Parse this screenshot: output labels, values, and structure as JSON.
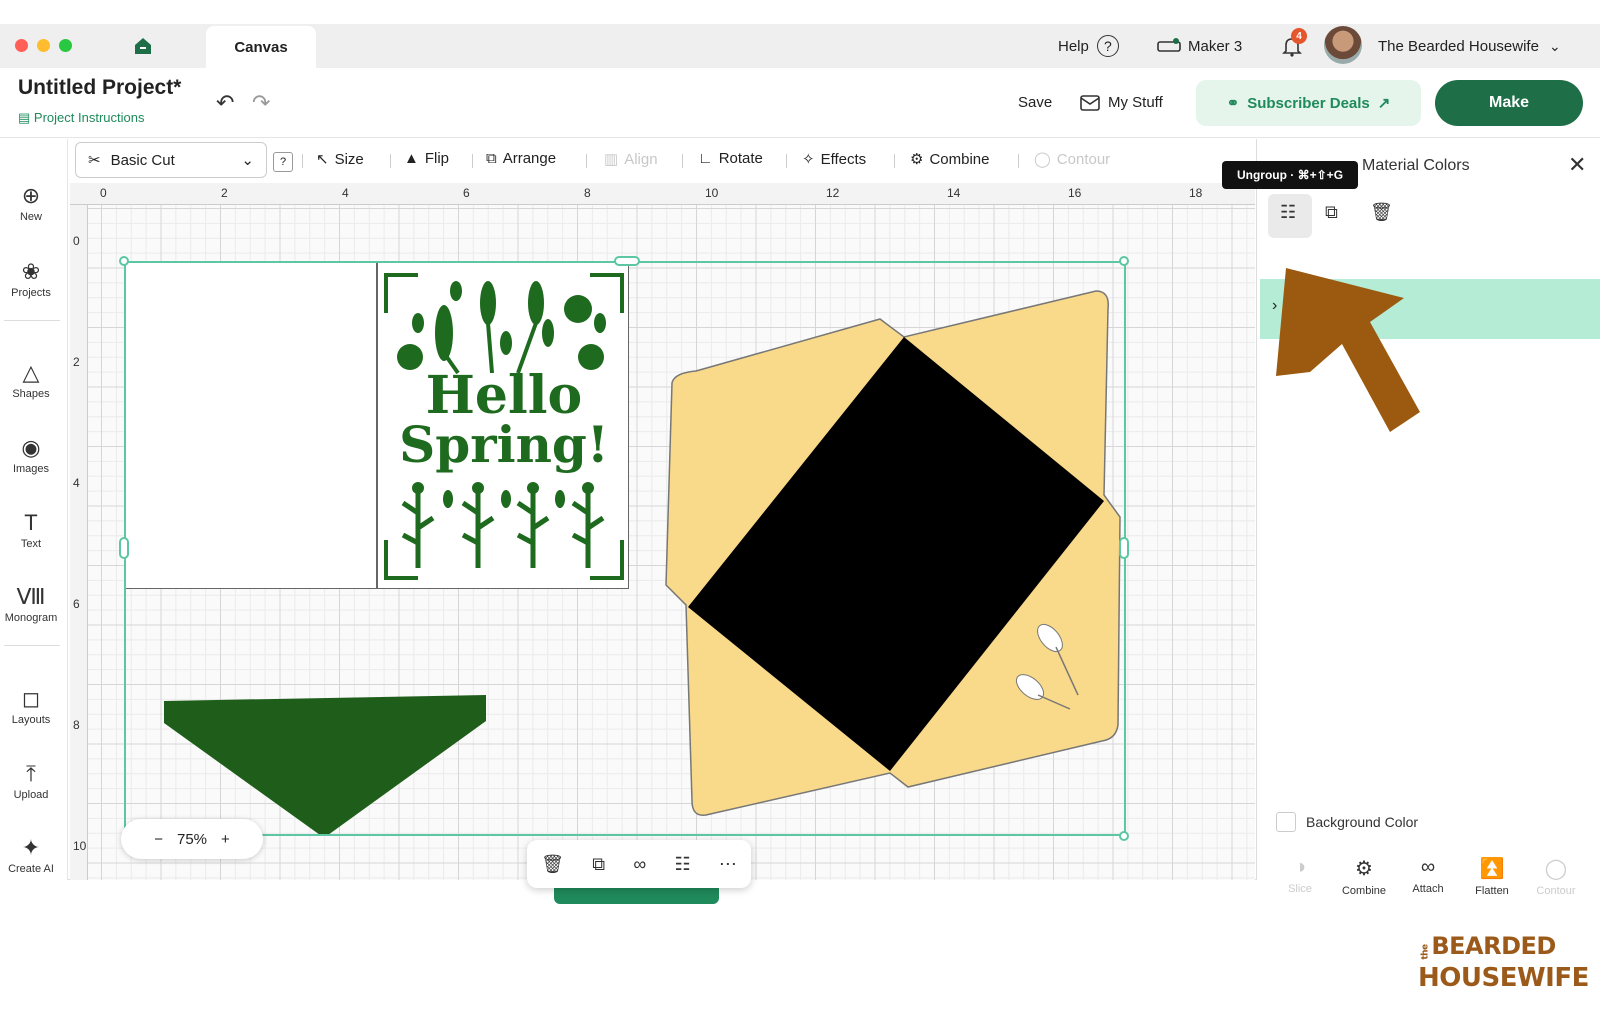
{
  "titlebar": {
    "tab": "Canvas",
    "help": "Help",
    "help_icon": "?",
    "machine": "Maker 3",
    "notifications": "4",
    "user": "The Bearded Housewife"
  },
  "header": {
    "title": "Untitled Project*",
    "instructions": "Project Instructions",
    "save": "Save",
    "my_stuff": "My Stuff",
    "subscriber_deals": "Subscriber Deals",
    "make": "Make"
  },
  "sidebar": {
    "items": [
      "New",
      "Projects",
      "Shapes",
      "Images",
      "Text",
      "Monogram",
      "Layouts",
      "Upload",
      "Create AI"
    ]
  },
  "toolbar": {
    "operation": "Basic Cut",
    "help_box": "?",
    "size": "Size",
    "flip": "Flip",
    "arrange": "Arrange",
    "align": "Align",
    "rotate": "Rotate",
    "effects": "Effects",
    "combine": "Combine",
    "contour": "Contour"
  },
  "ruler": {
    "top": [
      "0",
      "2",
      "4",
      "6",
      "8",
      "10",
      "12",
      "14",
      "16",
      "18"
    ],
    "left": [
      "0",
      "2",
      "4",
      "6",
      "8",
      "10"
    ]
  },
  "canvas": {
    "zoom": "75%",
    "zoom_minus": "−",
    "zoom_plus": "+",
    "card_line1": "Hello",
    "card_line2": "Spring!"
  },
  "right_panel": {
    "title": "Material Colors",
    "tooltip": "Ungroup · ⌘+⇧+G",
    "background_color": "Background Color",
    "actions": [
      "Slice",
      "Combine",
      "Attach",
      "Flatten",
      "Contour"
    ]
  },
  "brand": {
    "line1": "BEARDED",
    "line2": "HOUSEWIFE",
    "prefix": "the"
  },
  "colors": {
    "accent": "#1e6e47",
    "selection": "#5cc7a2",
    "envelope": "#f9d98a",
    "layer_highlight": "#b5ecd6",
    "arrow": "#9b5a10"
  }
}
